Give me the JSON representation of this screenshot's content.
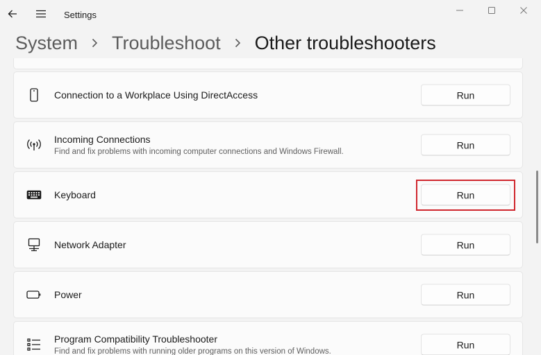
{
  "window": {
    "title": "Settings"
  },
  "breadcrumb": {
    "items": [
      "System",
      "Troubleshoot"
    ],
    "current": "Other troubleshooters"
  },
  "troubleshooters": [
    {
      "name": "Connection to a Workplace Using DirectAccess",
      "description": "",
      "icon": "phone-device-icon",
      "button": "Run"
    },
    {
      "name": "Incoming Connections",
      "description": "Find and fix problems with incoming computer connections and Windows Firewall.",
      "icon": "signal-broadcast-icon",
      "button": "Run"
    },
    {
      "name": "Keyboard",
      "description": "",
      "icon": "keyboard-icon",
      "button": "Run"
    },
    {
      "name": "Network Adapter",
      "description": "",
      "icon": "network-monitor-icon",
      "button": "Run"
    },
    {
      "name": "Power",
      "description": "",
      "icon": "battery-icon",
      "button": "Run"
    },
    {
      "name": "Program Compatibility Troubleshooter",
      "description": "Find and fix problems with running older programs on this version of Windows.",
      "icon": "list-icon",
      "button": "Run"
    }
  ],
  "colors": {
    "highlight": "#d0262d",
    "background": "#f3f3f3",
    "card": "#fbfbfb"
  }
}
